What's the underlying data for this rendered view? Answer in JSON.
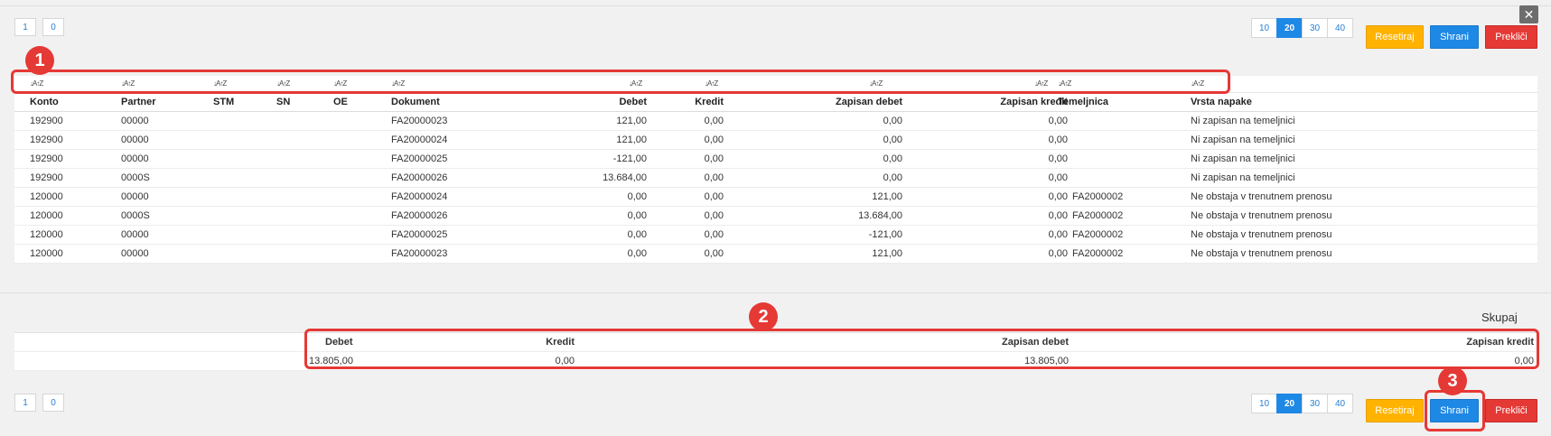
{
  "pagination_top": {
    "pages": [
      "1",
      "0"
    ]
  },
  "pagination_bottom": {
    "pages": [
      "1",
      "0"
    ]
  },
  "page_sizes": [
    "10",
    "20",
    "30",
    "40"
  ],
  "active_page_size": "20",
  "buttons": {
    "reset": "Resetiraj",
    "save": "Shrani",
    "cancel": "Prekliči",
    "close": "✕"
  },
  "sort_icon": "↓A↑Z",
  "columns": [
    "Konto",
    "Partner",
    "STM",
    "SN",
    "OE",
    "Dokument",
    "Debet",
    "Kredit",
    "Zapisan debet",
    "Zapisan kredit",
    "Temeljnica",
    "Vrsta napake"
  ],
  "rows": [
    [
      "192900",
      "00000",
      "",
      "",
      "",
      "FA20000023",
      "121,00",
      "0,00",
      "0,00",
      "0,00",
      "",
      "Ni zapisan na temeljnici"
    ],
    [
      "192900",
      "00000",
      "",
      "",
      "",
      "FA20000024",
      "121,00",
      "0,00",
      "0,00",
      "0,00",
      "",
      "Ni zapisan na temeljnici"
    ],
    [
      "192900",
      "00000",
      "",
      "",
      "",
      "FA20000025",
      "-121,00",
      "0,00",
      "0,00",
      "0,00",
      "",
      "Ni zapisan na temeljnici"
    ],
    [
      "192900",
      "0000S",
      "",
      "",
      "",
      "FA20000026",
      "13.684,00",
      "0,00",
      "0,00",
      "0,00",
      "",
      "Ni zapisan na temeljnici"
    ],
    [
      "120000",
      "00000",
      "",
      "",
      "",
      "FA20000024",
      "0,00",
      "0,00",
      "121,00",
      "0,00",
      "FA2000002",
      "Ne obstaja v trenutnem prenosu"
    ],
    [
      "120000",
      "0000S",
      "",
      "",
      "",
      "FA20000026",
      "0,00",
      "0,00",
      "13.684,00",
      "0,00",
      "FA2000002",
      "Ne obstaja v trenutnem prenosu"
    ],
    [
      "120000",
      "00000",
      "",
      "",
      "",
      "FA20000025",
      "0,00",
      "0,00",
      "-121,00",
      "0,00",
      "FA2000002",
      "Ne obstaja v trenutnem prenosu"
    ],
    [
      "120000",
      "00000",
      "",
      "",
      "",
      "FA20000023",
      "0,00",
      "0,00",
      "121,00",
      "0,00",
      "FA2000002",
      "Ne obstaja v trenutnem prenosu"
    ]
  ],
  "summary": {
    "title": "Skupaj",
    "columns": [
      "Debet",
      "Kredit",
      "Zapisan debet",
      "Zapisan kredit"
    ],
    "values": [
      "13.805,00",
      "0,00",
      "13.805,00",
      "0,00"
    ]
  },
  "callouts": [
    "1",
    "2",
    "3"
  ],
  "colors": {
    "accent": "#1e88e5",
    "warning": "#ffb300",
    "danger": "#e53935",
    "callout": "#e53935"
  }
}
